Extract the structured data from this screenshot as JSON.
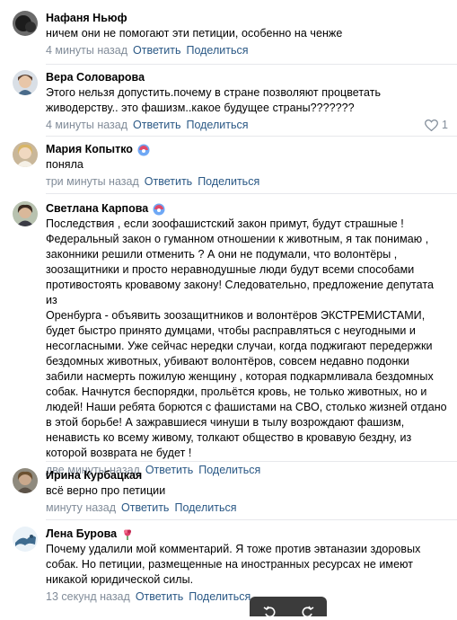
{
  "comments": [
    {
      "author": "Нафаня Ньюф",
      "text": "ничем они не помогают эти петиции, особенно на ченже",
      "time": "4 минуты назад",
      "reply": "Ответить",
      "share": "Поделиться"
    },
    {
      "author": "Вера Соловарова",
      "text": "Этого нельзя допустить.почему в стране позволяют процветать\nживодерству.. это фашизм..какое будущее страны???????",
      "time": "4 минуты назад",
      "reply": "Ответить",
      "share": "Поделиться",
      "likes": "1"
    },
    {
      "author": "Мария Копытко",
      "text": "поняла",
      "time": "три минуты назад",
      "reply": "Ответить",
      "share": "Поделиться"
    },
    {
      "author": "Светлана Карпова",
      "text": "Последствия , если зоофашистский закон примут, будут страшные !\nФедеральный закон о гуманном отношении к животным, я так понимаю ,\nзаконники решили отменить ? А они не подумали, что волонтёры ,\nзоозащитники и просто неравнодушные люди будут всеми способами\nпротивостоять кровавому закону! Следовательно, предложение депутата из\nОренбурга - объявить зоозащитников и волонтёров ЭКСТРЕМИСТАМИ,\nбудет быстро принято думцами, чтобы расправляться с неугодными и\nнесогласными. Уже сейчас нередки случаи, когда поджигают передержки\nбездомных животных, убивают волонтёров, совсем недавно подонки\nзабили насмерть пожилую женщину , которая подкармливала бездомных\nсобак. Начнутся беспорядки, прольётся кровь, не только животных, но и\nлюдей! Наши ребята борются с фашистами на СВО, столько жизней отдано\nв этой борьбе! А зажравшиеся чинуши в тылу возрождают фашизм,\nненависть ко всему живому, толкают общество в кровавую бездну, из\nкоторой возврата не будет !",
      "time": "две минуты назад",
      "reply": "Ответить",
      "share": "Поделиться"
    },
    {
      "author": "Ирина Курбацкая",
      "text": "всё верно про петиции",
      "time": "минуту назад",
      "reply": "Ответить",
      "share": "Поделиться"
    },
    {
      "author": "Лена Бурова",
      "text": "Почему удалили мой комментарий. Я тоже против эвтаназии здоровых\nсобак. Но петиции, размещенные на иностранных ресурсах не имеют\nникакой юридической силы.",
      "time": "13 секунд назад",
      "reply": "Ответить",
      "share": "Поделиться"
    }
  ],
  "colors": {
    "link": "#2a5885",
    "meta": "#818c99",
    "divider": "#e7e8ec"
  }
}
